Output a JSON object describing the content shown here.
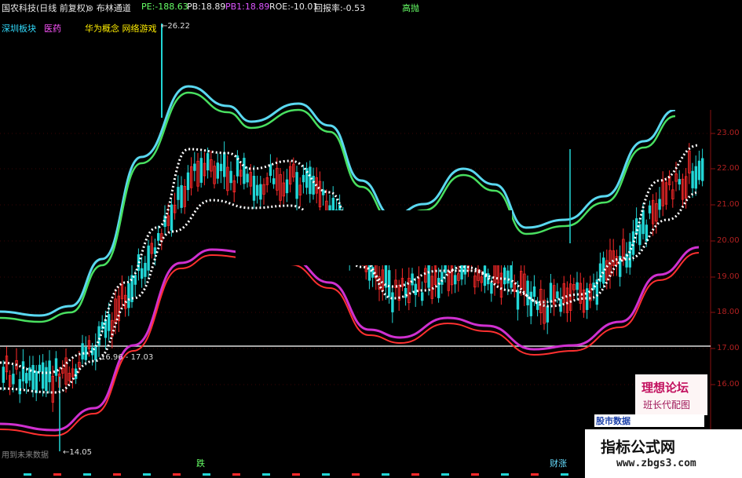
{
  "header": {
    "title": "国农科技(日线 前复权)",
    "indicator": "布林通道",
    "pe": "PE:-188.63",
    "pb": "PB:18.89",
    "pb1": "PB1:18.89",
    "roe": "ROE:-10.01",
    "return_rate": "回报率:-0.53",
    "right_label": "高抛"
  },
  "tags": {
    "sector": "深圳板块",
    "industry": "医药",
    "concepts": "华为概念 网络游戏"
  },
  "annotations": {
    "high": "26.22",
    "mid_band": "16.96 - 17.03",
    "low": "14.05",
    "future_note": "用到未来数据",
    "die_label": "跌",
    "zhang_label": "财涨"
  },
  "price_axis": [
    "23.00",
    "22.00",
    "21.00",
    "20.00",
    "19.00",
    "18.00",
    "17.00",
    "16.00"
  ],
  "watermarks": {
    "forum_line1": "理想论坛",
    "forum_line2": "班长代配图",
    "site_name": "指标公式网",
    "site_url": "www.zbgs3.com",
    "small_banner": "股市数据"
  },
  "colors": {
    "upper_band": "#6ff3f3",
    "lower_band": "#d030d0",
    "mid_line": "#ffffff",
    "up_candle": "#ff2a2a",
    "down_candle": "#22d6d6",
    "pe_text": "#66ff66",
    "pb1_text": "#dd55ff",
    "sector_text": "#33ddff",
    "concept_text": "#ffee00"
  }
}
